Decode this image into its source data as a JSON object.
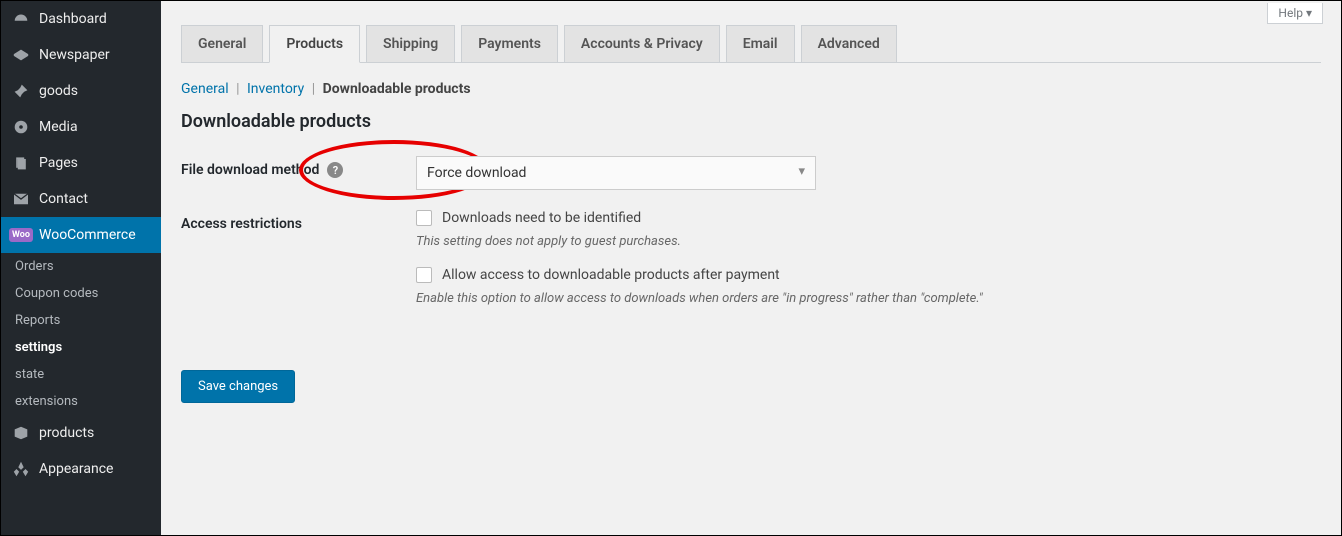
{
  "help": "Help",
  "sidebar": {
    "items": [
      {
        "label": "Dashboard",
        "icon": "dashboard"
      },
      {
        "label": "Newspaper",
        "icon": "newspaper"
      },
      {
        "label": "goods",
        "icon": "pin"
      },
      {
        "label": "Media",
        "icon": "media"
      },
      {
        "label": "Pages",
        "icon": "pages"
      },
      {
        "label": "Contact",
        "icon": "mail"
      },
      {
        "label": "WooCommerce",
        "icon": "woo"
      },
      {
        "label": "products",
        "icon": "products"
      },
      {
        "label": "Appearance",
        "icon": "appearance"
      }
    ],
    "subs": [
      {
        "label": "Orders"
      },
      {
        "label": "Coupon codes"
      },
      {
        "label": "Reports"
      },
      {
        "label": "settings"
      },
      {
        "label": "state"
      },
      {
        "label": "extensions"
      }
    ]
  },
  "tabs": [
    "General",
    "Products",
    "Shipping",
    "Payments",
    "Accounts & Privacy",
    "Email",
    "Advanced"
  ],
  "subtabs": {
    "general": "General",
    "inventory": "Inventory",
    "downloadable": "Downloadable products"
  },
  "section_title": "Downloadable products",
  "form": {
    "method_label": "File download method",
    "method_value": "Force download",
    "access_label": "Access restrictions",
    "cb1_label": "Downloads need to be identified",
    "cb1_desc": "This setting does not apply to guest purchases.",
    "cb2_label": "Allow access to downloadable products after payment",
    "cb2_desc": "Enable this option to allow access to downloads when orders are \"in progress\" rather than \"complete.\"",
    "save": "Save changes"
  }
}
